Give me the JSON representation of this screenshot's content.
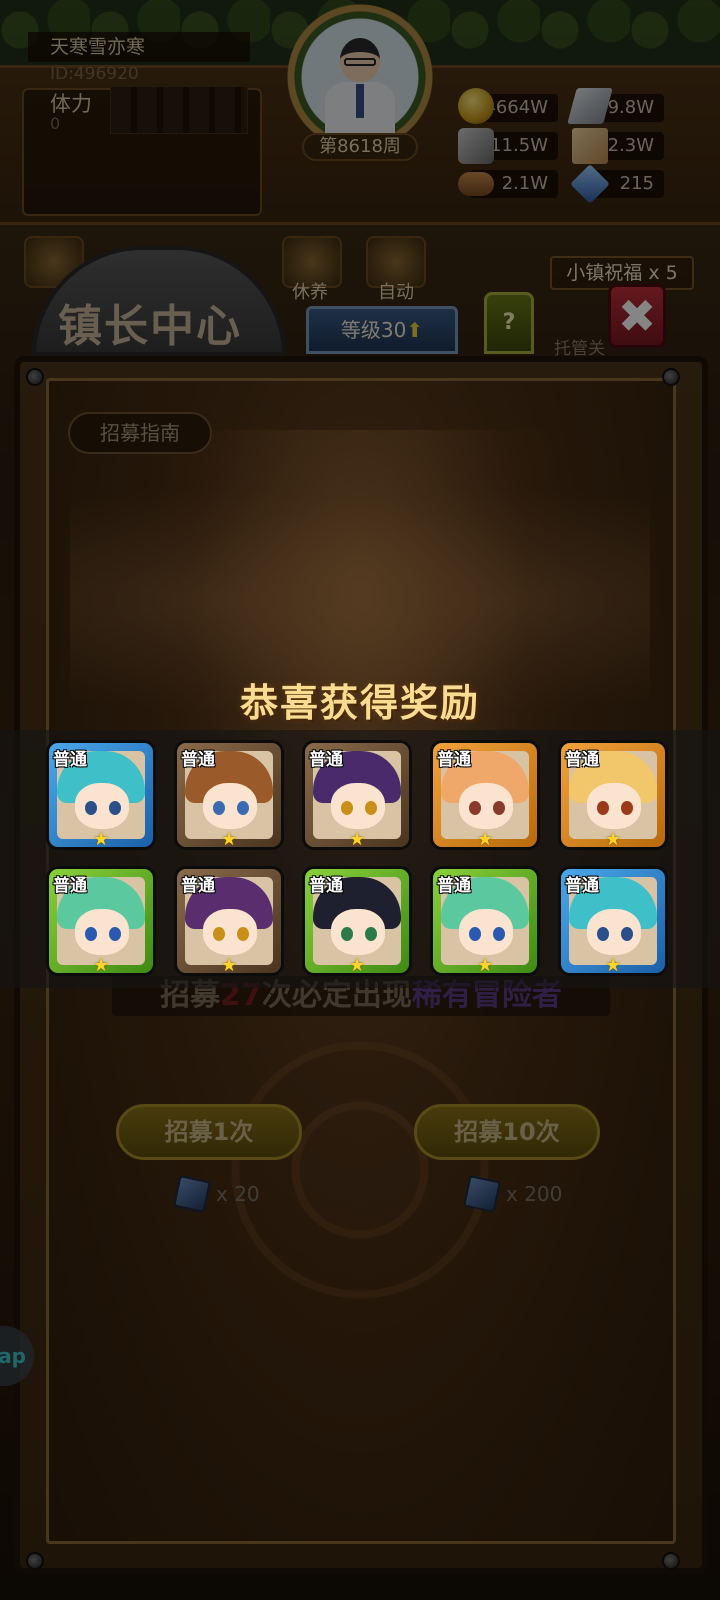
{
  "player": {
    "name": "天寒雪亦寒",
    "id": "ID:496920",
    "stamina_label": "体力",
    "stamina_value": "0",
    "week": "第8618周"
  },
  "resources": [
    {
      "icon": "gold-coin-icon",
      "value": "4664W"
    },
    {
      "icon": "iron-ingot-icon",
      "value": "9.8W"
    },
    {
      "icon": "stone-icon",
      "value": "11.5W"
    },
    {
      "icon": "cloth-icon",
      "value": "2.3W"
    },
    {
      "icon": "wood-log-icon",
      "value": "2.1W"
    },
    {
      "icon": "blue-gem-icon",
      "value": "215"
    }
  ],
  "top_bar": {
    "rest_label": "休养",
    "auto_label": "自动",
    "blessing_label": "小镇祝福 x 5",
    "auto_manage_label": "托管关"
  },
  "panel": {
    "title": "镇长中心",
    "level_label": "等级30",
    "help_label": "?",
    "close_label": "✖",
    "guide_label": "招募指南",
    "pity_prefix": "招募",
    "pity_count": "27",
    "pity_middle": "次必定出现",
    "pity_rare": "稀有冒险者",
    "recruit_one_label": "招募1次",
    "recruit_ten_label": "招募10次",
    "recruit_one_cost": "x 20",
    "recruit_ten_cost": "x 200",
    "side_app_label": "ap"
  },
  "reward": {
    "title": "恭喜获得奖励",
    "rarity_label": "普通",
    "cards": [
      {
        "frame": "blue",
        "hair": "#3fc0c8",
        "eye": "#2a4f8a"
      },
      {
        "frame": "brown",
        "hair": "#9a5a2a",
        "eye": "#3a6ab0"
      },
      {
        "frame": "brown",
        "hair": "#4a2a6a",
        "eye": "#c89018"
      },
      {
        "frame": "orange",
        "hair": "#f0a86a",
        "eye": "#8a3a2a"
      },
      {
        "frame": "orange",
        "hair": "#f2c66a",
        "eye": "#9a3a1a"
      },
      {
        "frame": "green",
        "hair": "#5cc8a0",
        "eye": "#2a5ab0"
      },
      {
        "frame": "brown",
        "hair": "#5a2e6e",
        "eye": "#c89018"
      },
      {
        "frame": "green",
        "hair": "#1e2030",
        "eye": "#2a7a4a"
      },
      {
        "frame": "green",
        "hair": "#5cc8a0",
        "eye": "#2a5ab0"
      },
      {
        "frame": "blue",
        "hair": "#3fc0c8",
        "eye": "#2a4f8a"
      }
    ]
  }
}
